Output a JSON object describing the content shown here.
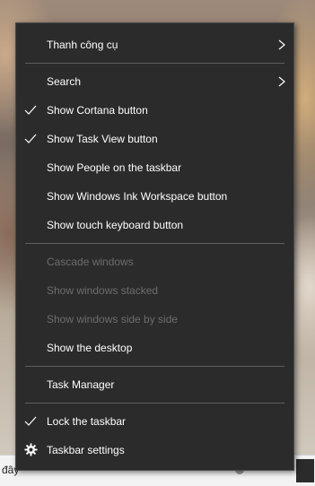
{
  "context_menu": {
    "items": [
      {
        "label": "Thanh công cụ",
        "submenu": true
      },
      {
        "label": "Search",
        "submenu": true
      },
      {
        "label": "Show Cortana button",
        "checked": true
      },
      {
        "label": "Show Task View button",
        "checked": true
      },
      {
        "label": "Show People on the taskbar"
      },
      {
        "label": "Show Windows Ink Workspace button"
      },
      {
        "label": "Show touch keyboard button"
      },
      {
        "label": "Cascade windows",
        "disabled": true
      },
      {
        "label": "Show windows stacked",
        "disabled": true
      },
      {
        "label": "Show windows side by side",
        "disabled": true
      },
      {
        "label": "Show the desktop"
      },
      {
        "label": "Task Manager"
      },
      {
        "label": "Lock the taskbar",
        "checked": true
      },
      {
        "label": "Taskbar settings",
        "icon": "gear-icon"
      }
    ]
  },
  "taskbar": {
    "search_text": "đây"
  },
  "colors": {
    "menu_background": "#2b2b2b",
    "menu_text": "#ffffff",
    "disabled_text": "#6d6d6d",
    "separator": "#5e5e5e"
  }
}
